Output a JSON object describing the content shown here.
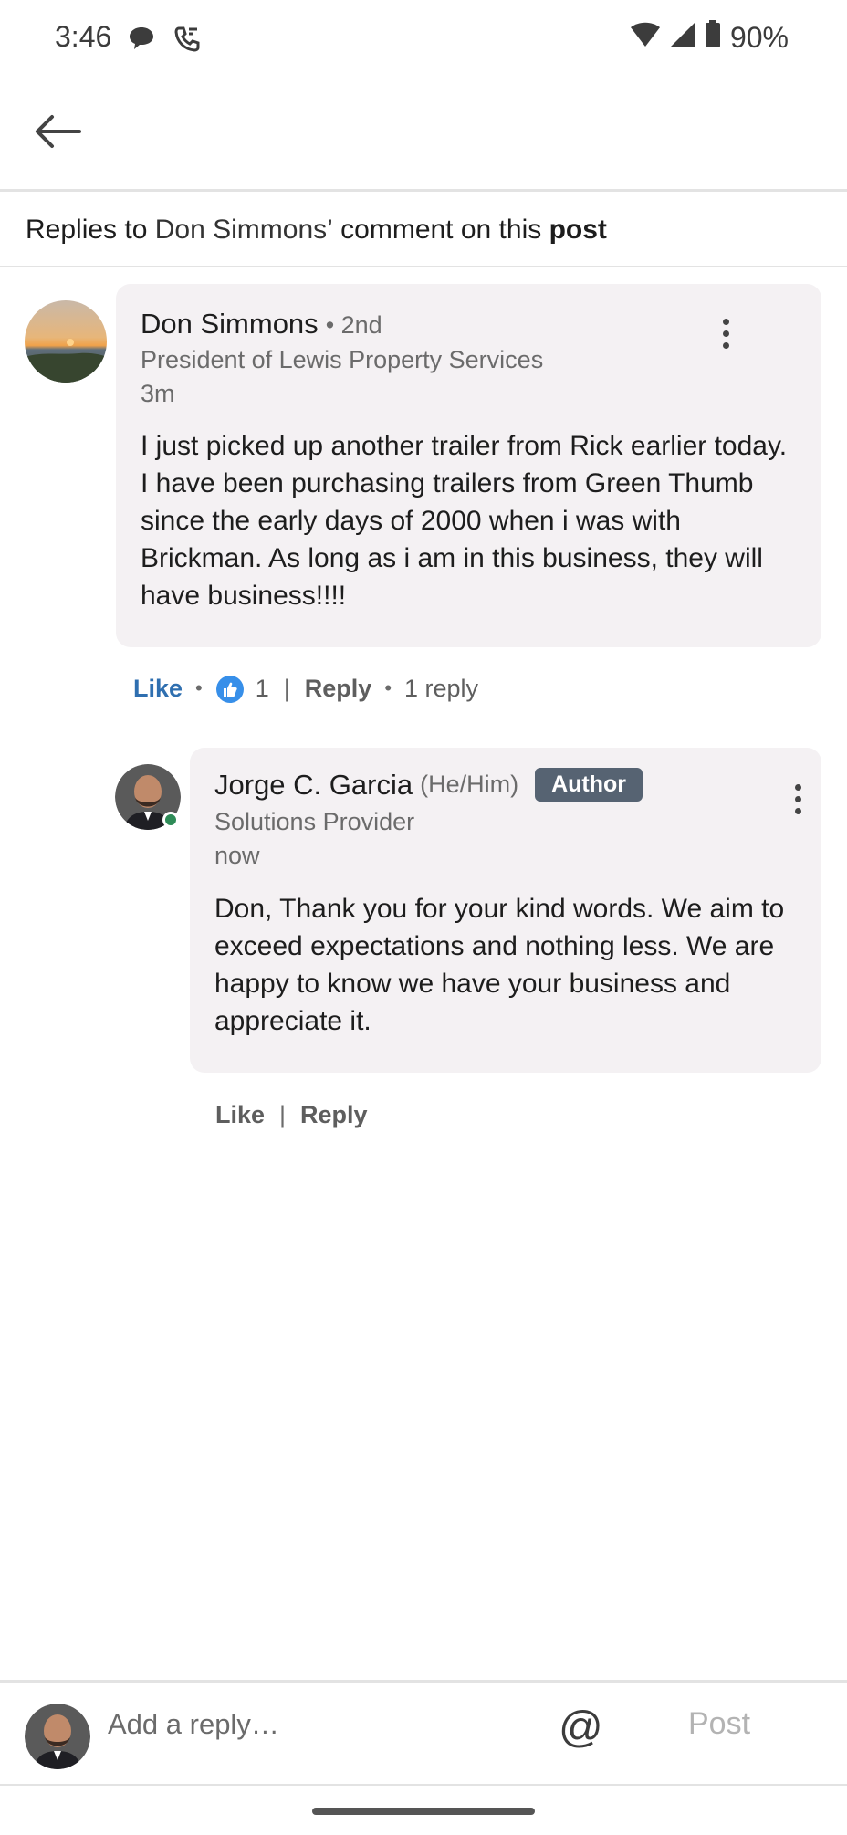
{
  "status_bar": {
    "time": "3:46",
    "battery": "90%",
    "icons": [
      "chat-bubble-icon",
      "phone-call-icon",
      "wifi-icon",
      "signal-icon",
      "battery-icon"
    ]
  },
  "header": {
    "back_icon": "arrow-left-icon"
  },
  "subheader": {
    "prefix": "Replies to ",
    "name": "Don Simmons’",
    "middle": " comment on this ",
    "post_word": "post"
  },
  "comment": {
    "name": "Don Simmons",
    "degree": "• 2nd",
    "headline": "President of Lewis Property Services",
    "time": "3m",
    "text": "I just picked up another trailer from Rick earlier today. I have been purchasing trailers from Green Thumb since the early days of 2000 when i was with Brickman. As long as i am in this business, they will have business!!!!",
    "actions": {
      "like": "Like",
      "reaction_count": "1",
      "reply": "Reply",
      "reply_count": "1 reply"
    }
  },
  "reply": {
    "name": "Jorge C. Garcia",
    "pronouns": "(He/Him)",
    "badge": "Author",
    "headline": "Solutions Provider",
    "time": "now",
    "text": "Don, Thank you for your kind words. We aim to exceed expectations and nothing less.  We are happy to know we have your business and appreciate it.",
    "actions": {
      "like": "Like",
      "reply": "Reply"
    }
  },
  "reply_bar": {
    "placeholder": "Add a reply…",
    "at_symbol": "@",
    "post_label": "Post"
  },
  "colors": {
    "like_active": "#2f6fb0",
    "bubble": "#f4f1f3",
    "author_badge": "#566372",
    "online": "#2e8b57"
  }
}
